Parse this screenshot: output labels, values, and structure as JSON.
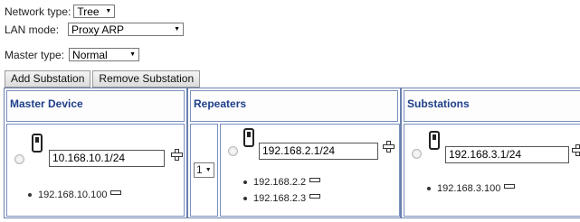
{
  "settings": {
    "network_type_label": "Network type:",
    "network_type_value": "Tree",
    "lan_mode_label": "LAN mode:",
    "lan_mode_value": "Proxy ARP",
    "master_type_label": "Master type:",
    "master_type_value": "Normal"
  },
  "toolbar": {
    "add_substation": "Add Substation",
    "remove_substation": "Remove Substation"
  },
  "master": {
    "header": "Master Device",
    "ip_value": "10.168.10.1/24",
    "addresses": [
      "192.168.10.100"
    ]
  },
  "repeaters": {
    "header": "Repeaters",
    "count_value": "1",
    "ip_value": "192.168.2.1/24",
    "addresses": [
      "192.168.2.2",
      "192.168.2.3"
    ]
  },
  "substations": {
    "header": "Substations",
    "ip_value": "192.168.3.1/24",
    "addresses": [
      "192.168.3.100"
    ]
  },
  "colors": {
    "header_text": "#1e3f8a",
    "panel_border": "#7a8fbe"
  },
  "icons": {
    "device": "device-icon",
    "add": "plus-icon",
    "remove": "minus-icon"
  }
}
